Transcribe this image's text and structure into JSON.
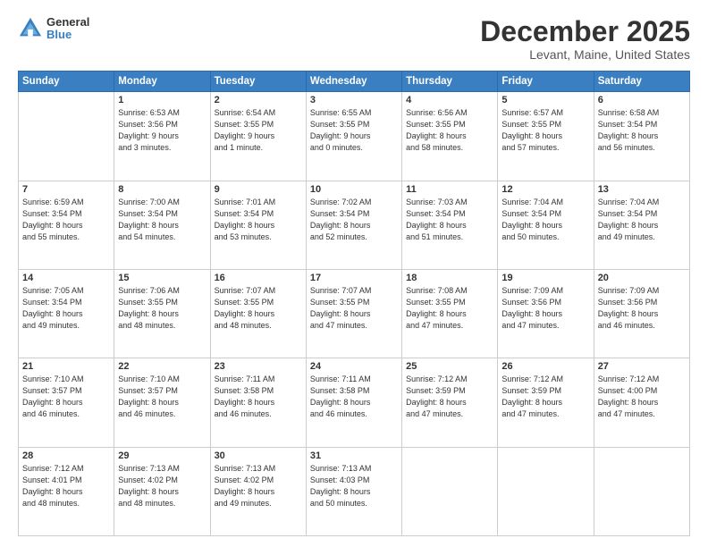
{
  "logo": {
    "general": "General",
    "blue": "Blue"
  },
  "title": "December 2025",
  "subtitle": "Levant, Maine, United States",
  "weekdays": [
    "Sunday",
    "Monday",
    "Tuesday",
    "Wednesday",
    "Thursday",
    "Friday",
    "Saturday"
  ],
  "weeks": [
    [
      {
        "day": "",
        "info": ""
      },
      {
        "day": "1",
        "info": "Sunrise: 6:53 AM\nSunset: 3:56 PM\nDaylight: 9 hours\nand 3 minutes."
      },
      {
        "day": "2",
        "info": "Sunrise: 6:54 AM\nSunset: 3:55 PM\nDaylight: 9 hours\nand 1 minute."
      },
      {
        "day": "3",
        "info": "Sunrise: 6:55 AM\nSunset: 3:55 PM\nDaylight: 9 hours\nand 0 minutes."
      },
      {
        "day": "4",
        "info": "Sunrise: 6:56 AM\nSunset: 3:55 PM\nDaylight: 8 hours\nand 58 minutes."
      },
      {
        "day": "5",
        "info": "Sunrise: 6:57 AM\nSunset: 3:55 PM\nDaylight: 8 hours\nand 57 minutes."
      },
      {
        "day": "6",
        "info": "Sunrise: 6:58 AM\nSunset: 3:54 PM\nDaylight: 8 hours\nand 56 minutes."
      }
    ],
    [
      {
        "day": "7",
        "info": "Sunrise: 6:59 AM\nSunset: 3:54 PM\nDaylight: 8 hours\nand 55 minutes."
      },
      {
        "day": "8",
        "info": "Sunrise: 7:00 AM\nSunset: 3:54 PM\nDaylight: 8 hours\nand 54 minutes."
      },
      {
        "day": "9",
        "info": "Sunrise: 7:01 AM\nSunset: 3:54 PM\nDaylight: 8 hours\nand 53 minutes."
      },
      {
        "day": "10",
        "info": "Sunrise: 7:02 AM\nSunset: 3:54 PM\nDaylight: 8 hours\nand 52 minutes."
      },
      {
        "day": "11",
        "info": "Sunrise: 7:03 AM\nSunset: 3:54 PM\nDaylight: 8 hours\nand 51 minutes."
      },
      {
        "day": "12",
        "info": "Sunrise: 7:04 AM\nSunset: 3:54 PM\nDaylight: 8 hours\nand 50 minutes."
      },
      {
        "day": "13",
        "info": "Sunrise: 7:04 AM\nSunset: 3:54 PM\nDaylight: 8 hours\nand 49 minutes."
      }
    ],
    [
      {
        "day": "14",
        "info": "Sunrise: 7:05 AM\nSunset: 3:54 PM\nDaylight: 8 hours\nand 49 minutes."
      },
      {
        "day": "15",
        "info": "Sunrise: 7:06 AM\nSunset: 3:55 PM\nDaylight: 8 hours\nand 48 minutes."
      },
      {
        "day": "16",
        "info": "Sunrise: 7:07 AM\nSunset: 3:55 PM\nDaylight: 8 hours\nand 48 minutes."
      },
      {
        "day": "17",
        "info": "Sunrise: 7:07 AM\nSunset: 3:55 PM\nDaylight: 8 hours\nand 47 minutes."
      },
      {
        "day": "18",
        "info": "Sunrise: 7:08 AM\nSunset: 3:55 PM\nDaylight: 8 hours\nand 47 minutes."
      },
      {
        "day": "19",
        "info": "Sunrise: 7:09 AM\nSunset: 3:56 PM\nDaylight: 8 hours\nand 47 minutes."
      },
      {
        "day": "20",
        "info": "Sunrise: 7:09 AM\nSunset: 3:56 PM\nDaylight: 8 hours\nand 46 minutes."
      }
    ],
    [
      {
        "day": "21",
        "info": "Sunrise: 7:10 AM\nSunset: 3:57 PM\nDaylight: 8 hours\nand 46 minutes."
      },
      {
        "day": "22",
        "info": "Sunrise: 7:10 AM\nSunset: 3:57 PM\nDaylight: 8 hours\nand 46 minutes."
      },
      {
        "day": "23",
        "info": "Sunrise: 7:11 AM\nSunset: 3:58 PM\nDaylight: 8 hours\nand 46 minutes."
      },
      {
        "day": "24",
        "info": "Sunrise: 7:11 AM\nSunset: 3:58 PM\nDaylight: 8 hours\nand 46 minutes."
      },
      {
        "day": "25",
        "info": "Sunrise: 7:12 AM\nSunset: 3:59 PM\nDaylight: 8 hours\nand 47 minutes."
      },
      {
        "day": "26",
        "info": "Sunrise: 7:12 AM\nSunset: 3:59 PM\nDaylight: 8 hours\nand 47 minutes."
      },
      {
        "day": "27",
        "info": "Sunrise: 7:12 AM\nSunset: 4:00 PM\nDaylight: 8 hours\nand 47 minutes."
      }
    ],
    [
      {
        "day": "28",
        "info": "Sunrise: 7:12 AM\nSunset: 4:01 PM\nDaylight: 8 hours\nand 48 minutes."
      },
      {
        "day": "29",
        "info": "Sunrise: 7:13 AM\nSunset: 4:02 PM\nDaylight: 8 hours\nand 48 minutes."
      },
      {
        "day": "30",
        "info": "Sunrise: 7:13 AM\nSunset: 4:02 PM\nDaylight: 8 hours\nand 49 minutes."
      },
      {
        "day": "31",
        "info": "Sunrise: 7:13 AM\nSunset: 4:03 PM\nDaylight: 8 hours\nand 50 minutes."
      },
      {
        "day": "",
        "info": ""
      },
      {
        "day": "",
        "info": ""
      },
      {
        "day": "",
        "info": ""
      }
    ]
  ]
}
